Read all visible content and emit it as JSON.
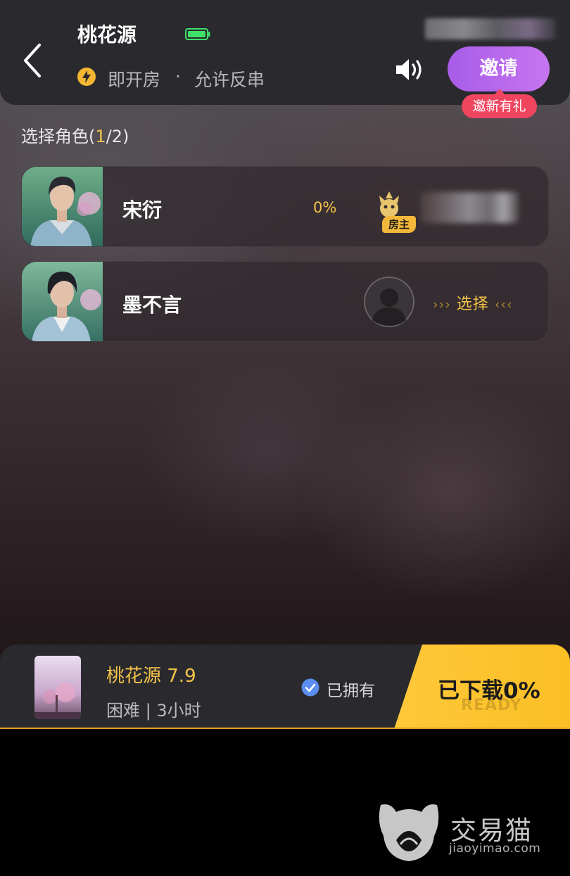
{
  "header": {
    "title": "桃花源",
    "mode": "即开房",
    "separator": "·",
    "rule": "允许反串",
    "invite_label": "邀请",
    "invite_badge": "邀新有礼"
  },
  "roles": {
    "section_label_prefix": "选择角色(",
    "current": "1",
    "section_label_suffix": "/2)",
    "items": [
      {
        "name": "宋衍",
        "progress": "0%",
        "host_badge": "房主"
      },
      {
        "name": "墨不言",
        "select_label": "选择",
        "arrows_left": "›››",
        "arrows_right": "‹‹‹"
      }
    ]
  },
  "game": {
    "title": "桃花源 7.9",
    "meta": "困难 | 3小时",
    "owned_label": "已拥有",
    "download_label": "已下载0%",
    "ready_text": "READY"
  },
  "watermark": {
    "name": "交易猫",
    "domain": "jiaoyimao.com"
  },
  "colors": {
    "accent_gold": "#f5c34a",
    "invite_purple": "#b566ec",
    "badge_red": "#f0455f",
    "battery_green": "#3ee06a",
    "check_blue": "#5b8ef0"
  },
  "icons": [
    "back-icon",
    "battery-icon",
    "bolt-icon",
    "speaker-icon",
    "check-icon",
    "host-avatar-icon",
    "empty-avatar-icon"
  ]
}
